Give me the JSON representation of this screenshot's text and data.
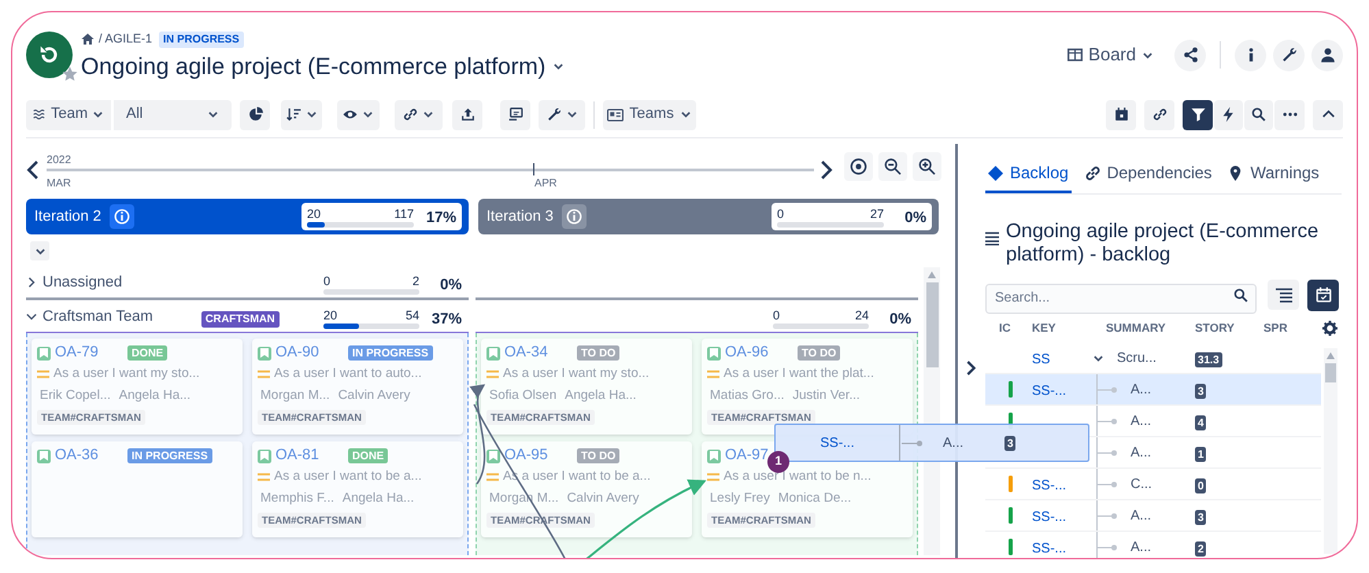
{
  "project": {
    "path": "/ AGILE-1",
    "status": "IN PROGRESS",
    "title": "Ongoing agile project (E-commerce platform)",
    "view": "Board"
  },
  "toolbar": {
    "team_select": "Team",
    "scope_select": "All",
    "teams_button": "Teams",
    "filter_on": true
  },
  "timeline": {
    "year": "2022",
    "months": [
      "MAR",
      "APR"
    ]
  },
  "iterations": [
    {
      "name": "Iteration 2",
      "active": true,
      "done": "20",
      "total": "117",
      "percent": "17%",
      "level": 0.17
    },
    {
      "name": "Iteration 3",
      "active": false,
      "done": "0",
      "total": "27",
      "percent": "0%",
      "level": 0
    }
  ],
  "teams": [
    {
      "name": "Unassigned",
      "expanded": false,
      "progress": [
        {
          "done": "0",
          "total": "2",
          "percent": "0%",
          "level": 0
        }
      ]
    },
    {
      "name": "Craftsman Team",
      "badge": "CRAFTSMAN",
      "expanded": true,
      "progress": [
        {
          "done": "20",
          "total": "54",
          "percent": "37%",
          "level": 0.37
        },
        {
          "done": "0",
          "total": "24",
          "percent": "0%",
          "level": 0
        }
      ],
      "lanes": [
        {
          "cards": [
            {
              "key": "OA-79",
              "status": {
                "label": "DONE",
                "kind": "done"
              },
              "summary": "As a user I want my sto...",
              "assignees": [
                "Erik Copel...",
                "Angela Ha..."
              ],
              "tag": "TEAM#CRAFTSMAN"
            },
            {
              "key": "OA-90",
              "status": {
                "label": "IN PROGRESS",
                "kind": "in_progress"
              },
              "summary": "As a user I want to auto...",
              "assignees": [
                "Morgan M...",
                "Calvin Avery"
              ],
              "tag": "TEAM#CRAFTSMAN"
            },
            {
              "key": "OA-36",
              "status": {
                "label": "IN PROGRESS",
                "kind": "in_progress"
              }
            },
            {
              "key": "OA-81",
              "status": {
                "label": "DONE",
                "kind": "done"
              },
              "summary": "As a user I want to be a...",
              "assignees": [
                "Memphis F...",
                "Angela Ha..."
              ],
              "tag": "TEAM#CRAFTSMAN"
            }
          ]
        },
        {
          "cards": [
            {
              "key": "OA-34",
              "status": {
                "label": "TO DO",
                "kind": "todo"
              },
              "summary": "As a user I want my sto...",
              "assignees": [
                "Sofia Olsen",
                "Angela Ha..."
              ],
              "tag": "TEAM#CRAFTSMAN"
            },
            {
              "key": "OA-96",
              "status": {
                "label": "TO DO",
                "kind": "todo"
              },
              "summary": "As a user I want the plat...",
              "assignees": [
                "Matias Gro...",
                "Justin Ver..."
              ],
              "tag": "TEAM#CRAFTSMAN"
            },
            {
              "key": "OA-95",
              "status": {
                "label": "TO DO",
                "kind": "todo"
              },
              "summary": "As a user I want to be a...",
              "assignees": [
                "Morgan M...",
                "Calvin Avery"
              ],
              "tag": "TEAM#CRAFTSMAN"
            },
            {
              "key": "OA-97",
              "summary": "As a user I want to be n...",
              "assignees": [
                "Lesly Frey",
                "Monica De..."
              ],
              "tag": "TEAM#CRAFTSMAN"
            }
          ]
        }
      ]
    }
  ],
  "drag_preview": {
    "key": "SS-...",
    "summary": "A...",
    "story": "3",
    "count": "1"
  },
  "panel": {
    "tabs": [
      {
        "label": "Backlog",
        "selected": true
      },
      {
        "label": "Dependencies",
        "selected": false
      },
      {
        "label": "Warnings",
        "selected": false
      }
    ],
    "title": "Ongoing agile project (E-commerce platform) - backlog",
    "search_placeholder": "Search...",
    "columns": [
      "IC",
      "KEY",
      "SUMMARY",
      "STORY",
      "SPR"
    ],
    "rows": [
      {
        "key": "SS",
        "summary": "Scru...",
        "story": "31.3",
        "expanded": true,
        "selected": false,
        "children": [
          {
            "key": "SS-...",
            "summary": "A...",
            "story": "3",
            "color": "#16a34a",
            "selected": true
          },
          {
            "summary": "A...",
            "story": "4",
            "color": "#16a34a",
            "selected": false
          },
          {
            "summary": "A...",
            "story": "1",
            "selected": false
          },
          {
            "key": "SS-...",
            "summary": "C...",
            "story": "0",
            "color": "#f59e0b",
            "selected": false
          },
          {
            "key": "SS-...",
            "summary": "A...",
            "story": "3",
            "color": "#16a34a",
            "selected": false
          },
          {
            "key": "SS-...",
            "summary": "A...",
            "story": "2",
            "color": "#16a34a",
            "selected": false
          }
        ]
      }
    ]
  }
}
